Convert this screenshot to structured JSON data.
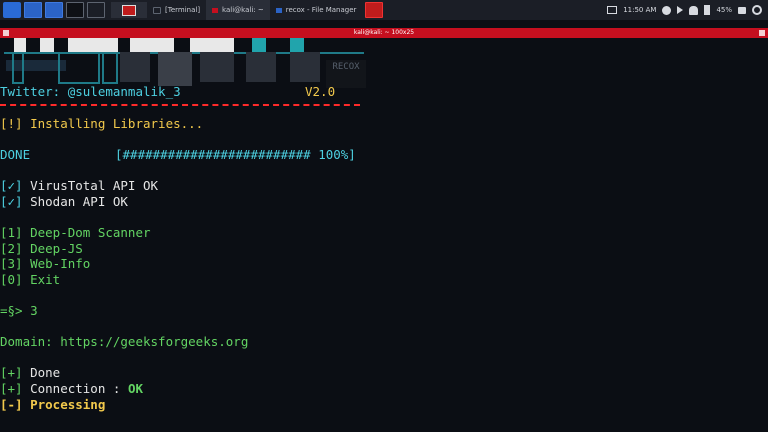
{
  "taskbar": {
    "tasks": [
      {
        "label": "[Terminal]"
      },
      {
        "label": "kali@kali: ~"
      },
      {
        "label": "recox - File Manager"
      }
    ],
    "clock": "11:50 AM",
    "battery": "45%"
  },
  "window": {
    "title": "kali@kali: ~ 100x25"
  },
  "banner": {
    "recox_label": "RECOX"
  },
  "terminal": {
    "twitter": "Twitter: @sulemanmalik_3",
    "version": "V2.0",
    "installing": "[!] Installing Libraries...",
    "done_word": "DONE",
    "progress": "[######################### 100%]",
    "progress_percent": 100,
    "api_checks": [
      {
        "mark": "[✓]",
        "label": " VirusTotal API OK"
      },
      {
        "mark": "[✓]",
        "label": " Shodan API OK"
      }
    ],
    "menu": [
      "[1] Deep-Dom Scanner",
      "[2] Deep-JS",
      "[3] Web-Info",
      "[0] Exit"
    ],
    "prompt": "=§> 3",
    "domain": "Domain: https://geeksforgeeks.org",
    "results": [
      {
        "mark": "[+]",
        "text": " Done"
      },
      {
        "mark": "[+]",
        "text": " Connection : ",
        "value": "OK"
      }
    ],
    "processing": "[-] Processing"
  },
  "colors": {
    "background": "#0b0e14",
    "titlebar": "#c50f1f",
    "yellow": "#f2c94c",
    "green": "#63d463",
    "cyan": "#4dd0e1",
    "red": "#ff3b3b"
  },
  "icons": {
    "start": "kali-dragon-icon",
    "volume": "speaker-icon",
    "notifications": "bell-icon",
    "battery": "battery-icon",
    "lock": "lock-icon",
    "power": "power-icon"
  }
}
